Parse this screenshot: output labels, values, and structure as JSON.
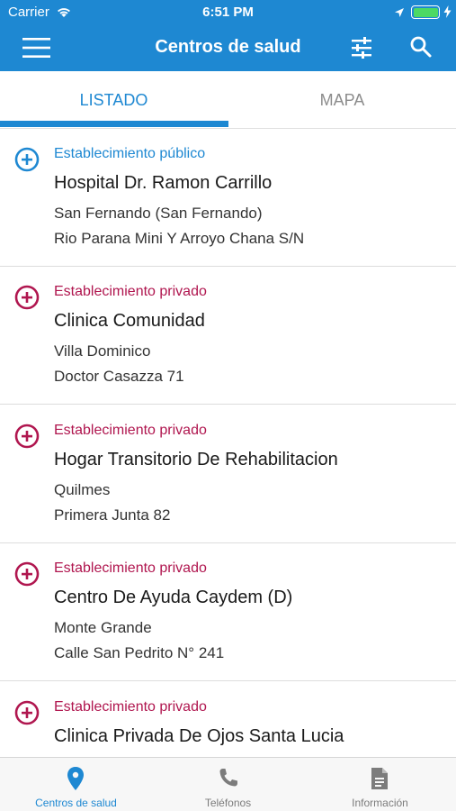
{
  "statusbar": {
    "carrier": "Carrier",
    "time": "6:51 PM"
  },
  "navbar": {
    "title": "Centros de salud"
  },
  "tabs": [
    {
      "label": "LISTADO",
      "active": true
    },
    {
      "label": "MAPA",
      "active": false
    }
  ],
  "colors": {
    "accent": "#1e88d2",
    "public": "#1e88d2",
    "private": "#b0164f",
    "battery": "#4cd964"
  },
  "items": [
    {
      "type": "Establecimiento público",
      "kind": "public",
      "name": "Hospital Dr. Ramon Carrillo",
      "city": "San Fernando (San Fernando)",
      "address": "Rio Parana Mini Y Arroyo Chana S/N"
    },
    {
      "type": "Establecimiento privado",
      "kind": "private",
      "name": "Clinica Comunidad",
      "city": "Villa Dominico",
      "address": "Doctor Casazza 71"
    },
    {
      "type": "Establecimiento privado",
      "kind": "private",
      "name": "Hogar Transitorio De Rehabilitacion",
      "city": "Quilmes",
      "address": "Primera Junta 82"
    },
    {
      "type": "Establecimiento privado",
      "kind": "private",
      "name": "Centro De Ayuda Caydem (D)",
      "city": "Monte Grande",
      "address": "Calle San Pedrito N° 241"
    },
    {
      "type": "Establecimiento privado",
      "kind": "private",
      "name": "Clinica Privada De Ojos Santa Lucia",
      "city": "",
      "address": ""
    }
  ],
  "bottom_tabs": [
    {
      "label": "Centros de salud",
      "icon": "location-pin-icon",
      "active": true
    },
    {
      "label": "Teléfonos",
      "icon": "phone-icon",
      "active": false
    },
    {
      "label": "Información",
      "icon": "document-icon",
      "active": false
    }
  ]
}
